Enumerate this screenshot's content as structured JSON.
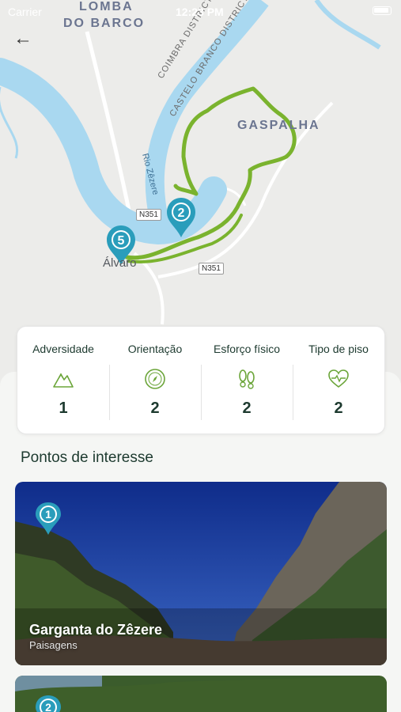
{
  "status_bar": {
    "carrier": "Carrier",
    "time": "12:23 PM"
  },
  "map": {
    "labels": {
      "lomba_line1": "LOMBA",
      "lomba_line2": "DO BARCO",
      "gaspalha": "GASPALHA",
      "alvaro": "Álvaro",
      "coimbra": "COIMBRA DISTRICT",
      "castelo": "CASTELO BRANCO DISTRICT",
      "rio": "Rio Zêzere",
      "road_top": "N351",
      "road_bottom": "N351"
    },
    "markers": [
      "2",
      "5"
    ],
    "route_color": "#7ab32e",
    "river_color": "#a9d8f0",
    "marker_color": "#2a9dbb"
  },
  "stats": [
    {
      "label": "Adversidade",
      "value": "1",
      "icon": "mountain-icon"
    },
    {
      "label": "Orientação",
      "value": "2",
      "icon": "compass-icon"
    },
    {
      "label": "Esforço físico",
      "value": "2",
      "icon": "footprints-icon"
    },
    {
      "label": "Tipo de piso",
      "value": "2",
      "icon": "heart-pulse-icon"
    }
  ],
  "section_title": "Pontos de interesse",
  "poi": [
    {
      "number": "1",
      "title": "Garganta do Zêzere",
      "category": "Paisagens"
    },
    {
      "number": "2"
    }
  ],
  "colors": {
    "accent": "#6ba539",
    "dark_green": "#1d3a2f"
  }
}
